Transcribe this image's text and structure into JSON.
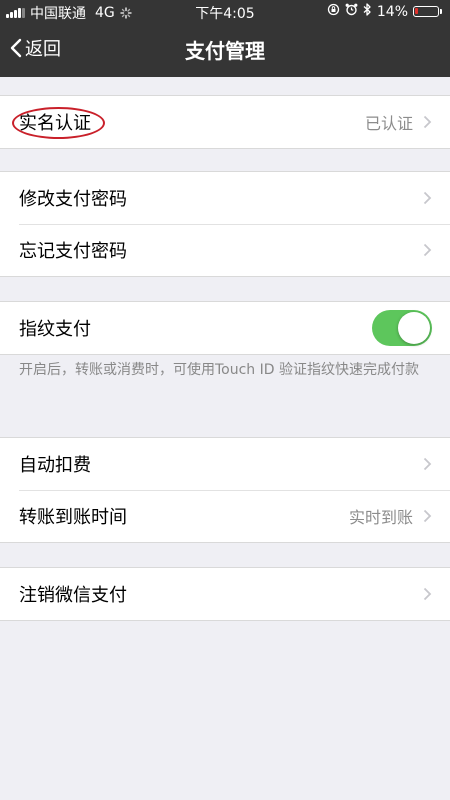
{
  "status_bar": {
    "carrier": "中国联通",
    "network": "4G",
    "time": "下午4:05",
    "battery": "14%",
    "battery_level": 0.14,
    "battery_color": "#e0302a"
  },
  "nav": {
    "back_label": "返回",
    "title": "支付管理"
  },
  "sections": {
    "identity": {
      "label": "实名认证",
      "value": "已认证"
    },
    "change_pwd": {
      "label": "修改支付密码"
    },
    "forgot_pwd": {
      "label": "忘记支付密码"
    },
    "fingerprint": {
      "label": "指纹支付",
      "enabled": true,
      "toggle_color": "#5dc65c"
    },
    "fingerprint_hint": "开启后，转账或消费时，可使用Touch ID 验证指纹快速完成付款",
    "auto_deduct": {
      "label": "自动扣费"
    },
    "transfer_time": {
      "label": "转账到账时间",
      "value": "实时到账"
    },
    "cancel": {
      "label": "注销微信支付"
    }
  },
  "colors": {
    "nav_bg": "#353535",
    "page_bg": "#efeff4",
    "highlight_oval": "#c9202a"
  }
}
